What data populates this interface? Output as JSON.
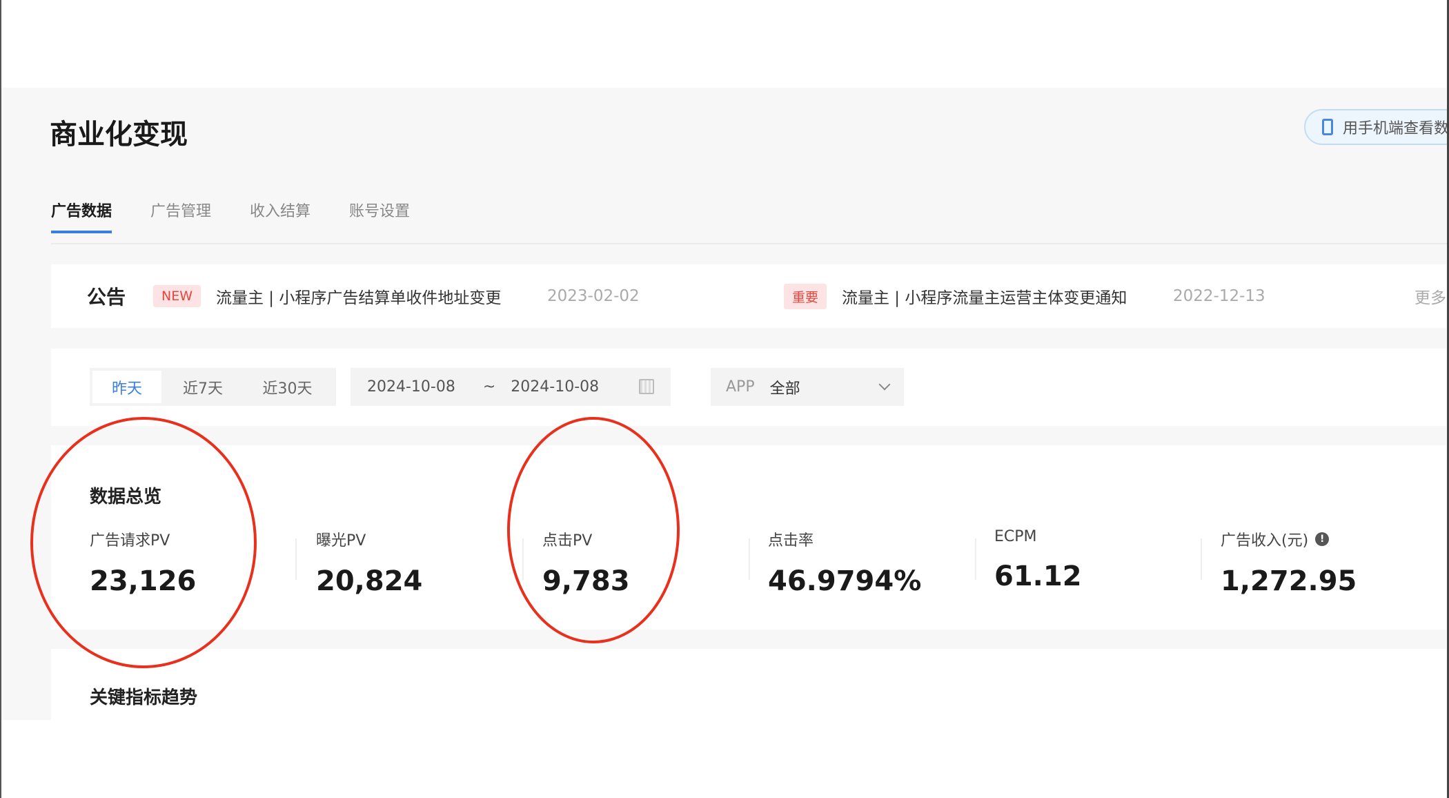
{
  "header": {
    "title": "商业化变现",
    "phone_button": "用手机端查看数据"
  },
  "tabs": [
    {
      "label": "广告数据",
      "active": true
    },
    {
      "label": "广告管理"
    },
    {
      "label": "收入结算"
    },
    {
      "label": "账号设置"
    }
  ],
  "announcement": {
    "title": "公告",
    "items": [
      {
        "badge": "NEW",
        "text": "流量主 | 小程序广告结算单收件地址变更",
        "date": "2023-02-02"
      },
      {
        "badge": "重要",
        "text": "流量主 | 小程序流量主运营主体变更通知",
        "date": "2022-12-13"
      }
    ],
    "more": "更多"
  },
  "filter": {
    "ranges": [
      "昨天",
      "近7天",
      "近30天"
    ],
    "selected": "昨天",
    "start_date": "2024-10-08",
    "separator": "~",
    "end_date": "2024-10-08",
    "app_label": "APP",
    "app_value": "全部"
  },
  "overview": {
    "title": "数据总览",
    "metrics": [
      {
        "label": "广告请求PV",
        "value": "23,126"
      },
      {
        "label": "曝光PV",
        "value": "20,824"
      },
      {
        "label": "点击PV",
        "value": "9,783"
      },
      {
        "label": "点击率",
        "value": "46.9794%"
      },
      {
        "label": "ECPM",
        "value": "61.12"
      },
      {
        "label": "广告收入(元)",
        "value": "1,272.95",
        "info_icon": "!"
      }
    ]
  },
  "trend": {
    "title": "关键指标趋势"
  },
  "colors": {
    "accent": "#3a7fe0",
    "annotation": "#e8301c",
    "badge_bg": "#fde3e3",
    "badge_text": "#e8453c"
  }
}
